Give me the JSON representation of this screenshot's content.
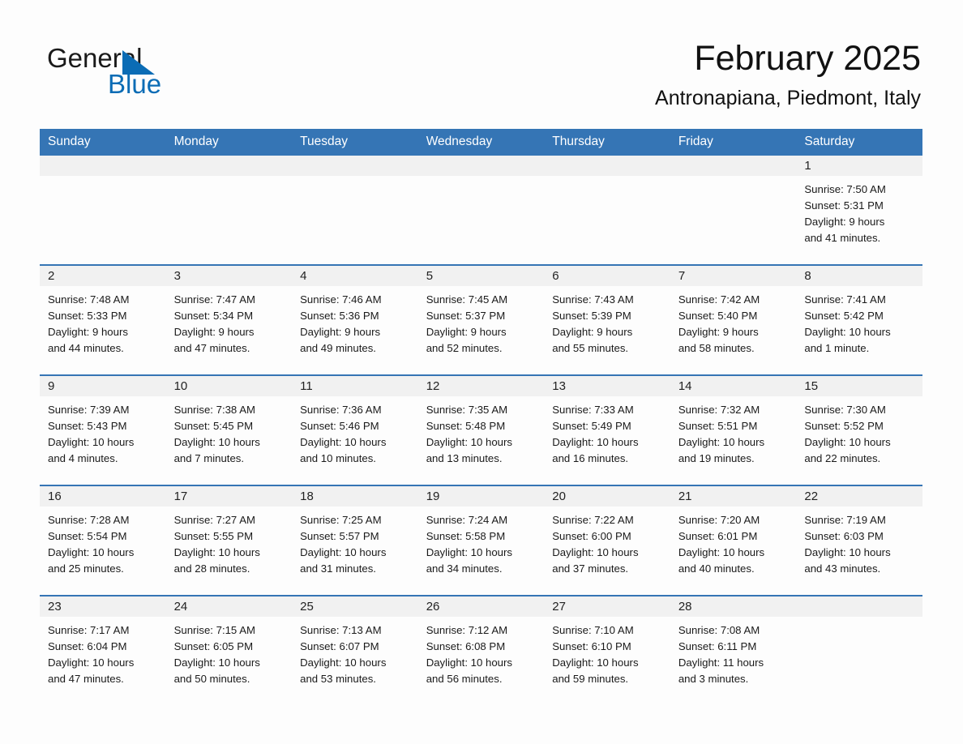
{
  "brand": {
    "name_line1": "General",
    "name_line2": "Blue",
    "logo_icon": "triangle-flag-icon",
    "accent_color": "#0b6cb5"
  },
  "header": {
    "month_title": "February 2025",
    "location": "Antronapiana, Piedmont, Italy"
  },
  "theme": {
    "header_blue": "#3575b5",
    "daynum_strip_gray": "#f1f1f1",
    "page_background": "#fdfdfd"
  },
  "calendar": {
    "weekday_headers": [
      "Sunday",
      "Monday",
      "Tuesday",
      "Wednesday",
      "Thursday",
      "Friday",
      "Saturday"
    ],
    "weeks": [
      [
        {
          "day": "",
          "sunrise": "",
          "sunset": "",
          "daylight_line1": "",
          "daylight_line2": ""
        },
        {
          "day": "",
          "sunrise": "",
          "sunset": "",
          "daylight_line1": "",
          "daylight_line2": ""
        },
        {
          "day": "",
          "sunrise": "",
          "sunset": "",
          "daylight_line1": "",
          "daylight_line2": ""
        },
        {
          "day": "",
          "sunrise": "",
          "sunset": "",
          "daylight_line1": "",
          "daylight_line2": ""
        },
        {
          "day": "",
          "sunrise": "",
          "sunset": "",
          "daylight_line1": "",
          "daylight_line2": ""
        },
        {
          "day": "",
          "sunrise": "",
          "sunset": "",
          "daylight_line1": "",
          "daylight_line2": ""
        },
        {
          "day": "1",
          "sunrise": "Sunrise: 7:50 AM",
          "sunset": "Sunset: 5:31 PM",
          "daylight_line1": "Daylight: 9 hours",
          "daylight_line2": "and 41 minutes."
        }
      ],
      [
        {
          "day": "2",
          "sunrise": "Sunrise: 7:48 AM",
          "sunset": "Sunset: 5:33 PM",
          "daylight_line1": "Daylight: 9 hours",
          "daylight_line2": "and 44 minutes."
        },
        {
          "day": "3",
          "sunrise": "Sunrise: 7:47 AM",
          "sunset": "Sunset: 5:34 PM",
          "daylight_line1": "Daylight: 9 hours",
          "daylight_line2": "and 47 minutes."
        },
        {
          "day": "4",
          "sunrise": "Sunrise: 7:46 AM",
          "sunset": "Sunset: 5:36 PM",
          "daylight_line1": "Daylight: 9 hours",
          "daylight_line2": "and 49 minutes."
        },
        {
          "day": "5",
          "sunrise": "Sunrise: 7:45 AM",
          "sunset": "Sunset: 5:37 PM",
          "daylight_line1": "Daylight: 9 hours",
          "daylight_line2": "and 52 minutes."
        },
        {
          "day": "6",
          "sunrise": "Sunrise: 7:43 AM",
          "sunset": "Sunset: 5:39 PM",
          "daylight_line1": "Daylight: 9 hours",
          "daylight_line2": "and 55 minutes."
        },
        {
          "day": "7",
          "sunrise": "Sunrise: 7:42 AM",
          "sunset": "Sunset: 5:40 PM",
          "daylight_line1": "Daylight: 9 hours",
          "daylight_line2": "and 58 minutes."
        },
        {
          "day": "8",
          "sunrise": "Sunrise: 7:41 AM",
          "sunset": "Sunset: 5:42 PM",
          "daylight_line1": "Daylight: 10 hours",
          "daylight_line2": "and 1 minute."
        }
      ],
      [
        {
          "day": "9",
          "sunrise": "Sunrise: 7:39 AM",
          "sunset": "Sunset: 5:43 PM",
          "daylight_line1": "Daylight: 10 hours",
          "daylight_line2": "and 4 minutes."
        },
        {
          "day": "10",
          "sunrise": "Sunrise: 7:38 AM",
          "sunset": "Sunset: 5:45 PM",
          "daylight_line1": "Daylight: 10 hours",
          "daylight_line2": "and 7 minutes."
        },
        {
          "day": "11",
          "sunrise": "Sunrise: 7:36 AM",
          "sunset": "Sunset: 5:46 PM",
          "daylight_line1": "Daylight: 10 hours",
          "daylight_line2": "and 10 minutes."
        },
        {
          "day": "12",
          "sunrise": "Sunrise: 7:35 AM",
          "sunset": "Sunset: 5:48 PM",
          "daylight_line1": "Daylight: 10 hours",
          "daylight_line2": "and 13 minutes."
        },
        {
          "day": "13",
          "sunrise": "Sunrise: 7:33 AM",
          "sunset": "Sunset: 5:49 PM",
          "daylight_line1": "Daylight: 10 hours",
          "daylight_line2": "and 16 minutes."
        },
        {
          "day": "14",
          "sunrise": "Sunrise: 7:32 AM",
          "sunset": "Sunset: 5:51 PM",
          "daylight_line1": "Daylight: 10 hours",
          "daylight_line2": "and 19 minutes."
        },
        {
          "day": "15",
          "sunrise": "Sunrise: 7:30 AM",
          "sunset": "Sunset: 5:52 PM",
          "daylight_line1": "Daylight: 10 hours",
          "daylight_line2": "and 22 minutes."
        }
      ],
      [
        {
          "day": "16",
          "sunrise": "Sunrise: 7:28 AM",
          "sunset": "Sunset: 5:54 PM",
          "daylight_line1": "Daylight: 10 hours",
          "daylight_line2": "and 25 minutes."
        },
        {
          "day": "17",
          "sunrise": "Sunrise: 7:27 AM",
          "sunset": "Sunset: 5:55 PM",
          "daylight_line1": "Daylight: 10 hours",
          "daylight_line2": "and 28 minutes."
        },
        {
          "day": "18",
          "sunrise": "Sunrise: 7:25 AM",
          "sunset": "Sunset: 5:57 PM",
          "daylight_line1": "Daylight: 10 hours",
          "daylight_line2": "and 31 minutes."
        },
        {
          "day": "19",
          "sunrise": "Sunrise: 7:24 AM",
          "sunset": "Sunset: 5:58 PM",
          "daylight_line1": "Daylight: 10 hours",
          "daylight_line2": "and 34 minutes."
        },
        {
          "day": "20",
          "sunrise": "Sunrise: 7:22 AM",
          "sunset": "Sunset: 6:00 PM",
          "daylight_line1": "Daylight: 10 hours",
          "daylight_line2": "and 37 minutes."
        },
        {
          "day": "21",
          "sunrise": "Sunrise: 7:20 AM",
          "sunset": "Sunset: 6:01 PM",
          "daylight_line1": "Daylight: 10 hours",
          "daylight_line2": "and 40 minutes."
        },
        {
          "day": "22",
          "sunrise": "Sunrise: 7:19 AM",
          "sunset": "Sunset: 6:03 PM",
          "daylight_line1": "Daylight: 10 hours",
          "daylight_line2": "and 43 minutes."
        }
      ],
      [
        {
          "day": "23",
          "sunrise": "Sunrise: 7:17 AM",
          "sunset": "Sunset: 6:04 PM",
          "daylight_line1": "Daylight: 10 hours",
          "daylight_line2": "and 47 minutes."
        },
        {
          "day": "24",
          "sunrise": "Sunrise: 7:15 AM",
          "sunset": "Sunset: 6:05 PM",
          "daylight_line1": "Daylight: 10 hours",
          "daylight_line2": "and 50 minutes."
        },
        {
          "day": "25",
          "sunrise": "Sunrise: 7:13 AM",
          "sunset": "Sunset: 6:07 PM",
          "daylight_line1": "Daylight: 10 hours",
          "daylight_line2": "and 53 minutes."
        },
        {
          "day": "26",
          "sunrise": "Sunrise: 7:12 AM",
          "sunset": "Sunset: 6:08 PM",
          "daylight_line1": "Daylight: 10 hours",
          "daylight_line2": "and 56 minutes."
        },
        {
          "day": "27",
          "sunrise": "Sunrise: 7:10 AM",
          "sunset": "Sunset: 6:10 PM",
          "daylight_line1": "Daylight: 10 hours",
          "daylight_line2": "and 59 minutes."
        },
        {
          "day": "28",
          "sunrise": "Sunrise: 7:08 AM",
          "sunset": "Sunset: 6:11 PM",
          "daylight_line1": "Daylight: 11 hours",
          "daylight_line2": "and 3 minutes."
        },
        {
          "day": "",
          "sunrise": "",
          "sunset": "",
          "daylight_line1": "",
          "daylight_line2": ""
        }
      ]
    ]
  }
}
